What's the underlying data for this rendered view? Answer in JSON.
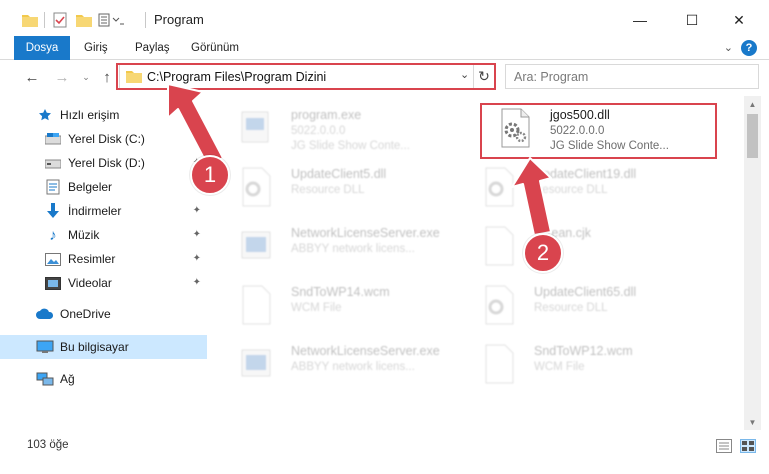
{
  "window": {
    "title": "Program",
    "minimize": "—",
    "maximize": "☐",
    "close": "✕"
  },
  "ribbon": {
    "tabs": [
      "Dosya",
      "Giriş",
      "Paylaş",
      "Görünüm"
    ],
    "help": "?"
  },
  "nav": {
    "address": "C:\\Program Files\\Program Dizini",
    "search_placeholder": "Ara: Program"
  },
  "sidebar": {
    "items": [
      {
        "label": "Hızlı erişim",
        "icon": "star-icon",
        "pinned": false
      },
      {
        "label": "Yerel Disk (C:)",
        "icon": "drive-icon",
        "pinned": true
      },
      {
        "label": "Yerel Disk (D:)",
        "icon": "drive-icon",
        "pinned": true
      },
      {
        "label": "Belgeler",
        "icon": "documents-icon",
        "pinned": true
      },
      {
        "label": "İndirmeler",
        "icon": "download-icon",
        "pinned": true
      },
      {
        "label": "Müzik",
        "icon": "music-icon",
        "pinned": true
      },
      {
        "label": "Resimler",
        "icon": "pictures-icon",
        "pinned": true
      },
      {
        "label": "Videolar",
        "icon": "videos-icon",
        "pinned": true
      },
      {
        "label": "OneDrive",
        "icon": "cloud-icon",
        "pinned": false
      },
      {
        "label": "Bu bilgisayar",
        "icon": "computer-icon",
        "pinned": false
      },
      {
        "label": "Ağ",
        "icon": "network-icon",
        "pinned": false
      }
    ]
  },
  "files": [
    {
      "name": "program.exe",
      "line1": "5022.0.0.0",
      "line2": "JG Slide Show Conte...",
      "icon": "exe-icon"
    },
    {
      "name": "jgos500.dll",
      "line1": "5022.0.0.0",
      "line2": "JG Slide Show Conte...",
      "icon": "dll-icon"
    },
    {
      "name": "UpdateClient5.dll",
      "line1": "Resource DLL",
      "line2": "",
      "icon": "dll-icon"
    },
    {
      "name": "UpdateClient19.dll",
      "line1": "Resource DLL",
      "line2": "",
      "icon": "dll-icon"
    },
    {
      "name": "NetworkLicenseServer.exe",
      "line1": "ABBYY network licens...",
      "line2": "",
      "icon": "exe-icon"
    },
    {
      "name": "korean.cjk",
      "line1": "",
      "line2": "",
      "icon": "file-icon"
    },
    {
      "name": "SndToWP14.wcm",
      "line1": "WCM File",
      "line2": "",
      "icon": "file-icon"
    },
    {
      "name": "UpdateClient65.dll",
      "line1": "Resource DLL",
      "line2": "",
      "icon": "dll-icon"
    },
    {
      "name": "NetworkLicenseServer.exe",
      "line1": "ABBYY network licens...",
      "line2": "",
      "icon": "exe-icon"
    },
    {
      "name": "SndToWP12.wcm",
      "line1": "WCM File",
      "line2": "",
      "icon": "file-icon"
    }
  ],
  "status": {
    "count": "103 öğe"
  },
  "callouts": [
    "1",
    "2"
  ],
  "colors": {
    "accent": "#1979ca",
    "highlight": "#d9444e",
    "selected": "#cce8ff"
  }
}
